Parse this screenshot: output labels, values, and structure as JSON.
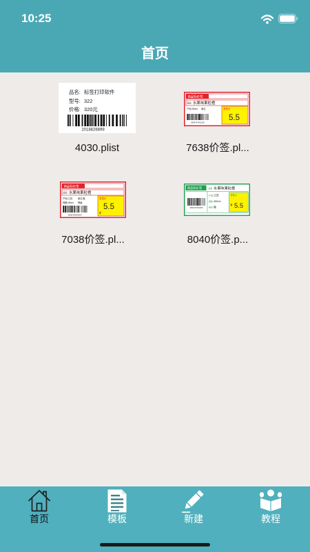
{
  "status_bar": {
    "time": "10:25"
  },
  "header": {
    "title": "首页"
  },
  "templates": [
    {
      "caption": "4030.plist",
      "label": {
        "lines": [
          {
            "key": "品名:",
            "value": "标签打印软件"
          },
          {
            "key": "型号:",
            "value": "322"
          },
          {
            "key": "价格:",
            "value": "320元"
          }
        ],
        "barcode_number": "2018826899"
      }
    },
    {
      "caption": "7638价签.pl...",
      "label": {
        "header": "商品标价签",
        "name_key": "品名",
        "name": "水果味果粒橙",
        "origin_key": "产地",
        "spec": "450ml",
        "unit_key": "单位",
        "price_key": "零售价",
        "price": "5.5",
        "barcode_number": "6954767461306"
      }
    },
    {
      "caption": "7038价签.pl...",
      "label": {
        "header": "商品标价签",
        "name_key": "品名",
        "name": "水果味果粒橙",
        "origin_key": "产地",
        "origin": "江苏",
        "unit_key": "单位",
        "unit": "瓶",
        "spec_key": "规格",
        "spec": "450ml",
        "grade_key": "等级",
        "price_key": "零售价",
        "currency": "¥",
        "price": "5.5",
        "barcode_number": "6906418200067"
      }
    },
    {
      "caption": "8040价签.p...",
      "label": {
        "header": "商品标价签",
        "name_key": "品名",
        "name": "水果味果粒橙",
        "origin_key": "产地",
        "origin": "江苏",
        "spec_key": "规格",
        "spec": "450ml",
        "unit_key": "单位",
        "unit": "瓶",
        "price_key": "零售价",
        "currency": "¥",
        "price": "5.5",
        "barcode_number": "6954767461306"
      }
    }
  ],
  "tabs": [
    {
      "label": "首页",
      "icon": "home-icon",
      "active": true
    },
    {
      "label": "模板",
      "icon": "document-icon",
      "active": false
    },
    {
      "label": "新建",
      "icon": "pencil-icon",
      "active": false
    },
    {
      "label": "教程",
      "icon": "reader-icon",
      "active": false
    }
  ],
  "colors": {
    "header": "#4aa8b5",
    "tabbar": "#50b0bd",
    "background": "#eeebe9",
    "tag_red": "#e3232b",
    "tag_green": "#1f9e4f",
    "price_yellow": "#fff200",
    "tab_label": "#ffffff",
    "active_tab_label": "#111111"
  }
}
